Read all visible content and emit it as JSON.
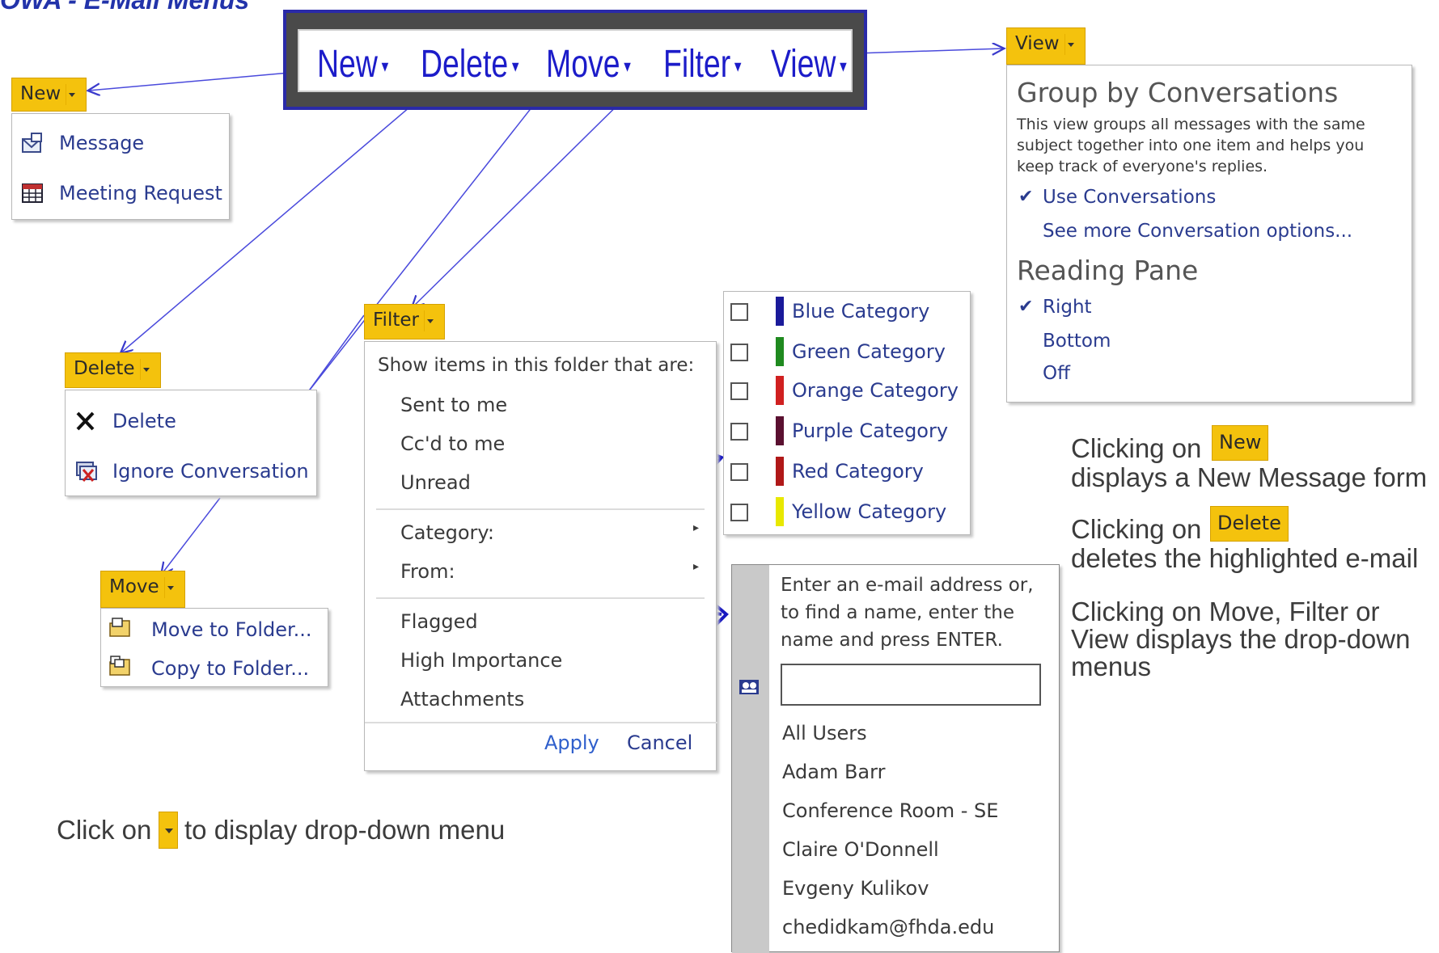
{
  "title": "OWA - E-Mail Menus",
  "toolbar": {
    "items": [
      "New",
      "Delete",
      "Move",
      "Filter",
      "View"
    ]
  },
  "new_menu": {
    "header": "New",
    "items": [
      "Message",
      "Meeting Request"
    ]
  },
  "delete_menu": {
    "header": "Delete",
    "items": [
      "Delete",
      "Ignore Conversation"
    ]
  },
  "move_menu": {
    "header": "Move",
    "items": [
      "Move to Folder...",
      "Copy to Folder..."
    ]
  },
  "filter_menu": {
    "header": "Filter",
    "intro": "Show items in this folder that are:",
    "items_a": [
      "Sent to me",
      "Cc'd to me",
      "Unread"
    ],
    "category": "Category:",
    "from": "From:",
    "items_b": [
      "Flagged",
      "High Importance",
      "Attachments"
    ],
    "apply": "Apply",
    "cancel": "Cancel"
  },
  "category_menu": {
    "items": [
      {
        "label": "Blue Category",
        "color": "#1a1a9a"
      },
      {
        "label": "Green Category",
        "color": "#1f8a1f"
      },
      {
        "label": "Orange Category",
        "color": "#d02020"
      },
      {
        "label": "Purple Category",
        "color": "#5a1030"
      },
      {
        "label": "Red Category",
        "color": "#b01818"
      },
      {
        "label": "Yellow Category",
        "color": "#e8e800"
      }
    ]
  },
  "from_menu": {
    "instructions_1": "Enter an e-mail address or,",
    "instructions_2": "to find a name, enter the",
    "instructions_3": "name and press ENTER.",
    "input_value": "",
    "contacts": [
      "All Users",
      "Adam Barr",
      "Conference Room - SE",
      "Claire O'Donnell",
      "Evgeny Kulikov",
      "chedidkam@fhda.edu"
    ]
  },
  "view_menu": {
    "header": "View",
    "group_title": "Group by Conversations",
    "group_desc_1": "This view groups all messages with the same",
    "group_desc_2": "subject together into one item and helps you",
    "group_desc_3": "keep track of everyone's replies.",
    "use_conversations": "Use Conversations",
    "more_options": "See more Conversation options...",
    "reading_title": "Reading Pane",
    "reading_options": [
      "Right",
      "Bottom",
      "Off"
    ]
  },
  "explanations": {
    "clicking_on": "Clicking on",
    "new_label": "New",
    "new_desc": "displays a New Message form",
    "delete_label": "Delete",
    "delete_desc": "deletes the highlighted e-mail",
    "other_1": "Clicking on Move, Filter or",
    "other_2": "View displays the drop-down",
    "other_3": "menus",
    "click_prefix": "Click on",
    "click_suffix": "to display drop-down menu"
  },
  "colors": {
    "accent_orange": "#f4c20d",
    "arrow_blue": "#1c1cc9",
    "menu_text_blue": "#2a3b8f"
  }
}
